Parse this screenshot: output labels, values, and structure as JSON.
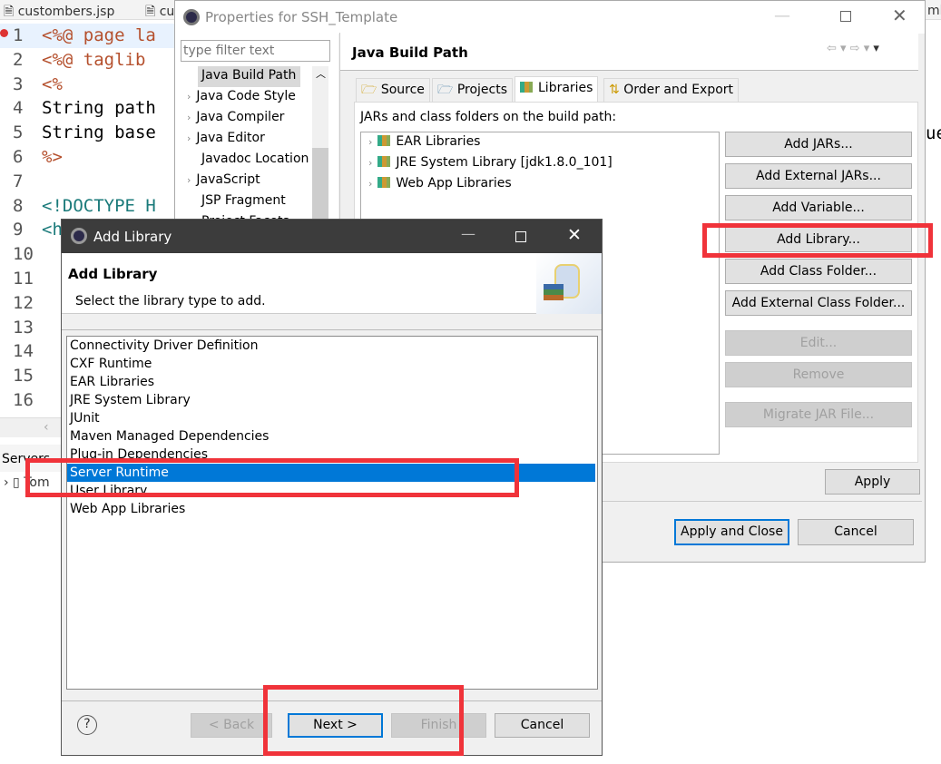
{
  "editor": {
    "tabs": [
      "custombers.jsp",
      "cu"
    ],
    "right_fragments": [
      "ml",
      "ue"
    ],
    "line_numbers": [
      "1",
      "2",
      "3",
      "4",
      "5",
      "6",
      "7",
      "8",
      "9",
      "10",
      "11",
      "12",
      "13",
      "14",
      "15",
      "16"
    ],
    "code_lines": [
      "<%@ page la",
      "<%@ taglib",
      "<%",
      "String path",
      "String base",
      "%>",
      "",
      "<!DOCTYPE H",
      "<h",
      "",
      "",
      "",
      "",
      "",
      "",
      ""
    ],
    "servers_label": "Servers",
    "server_item": "Tom"
  },
  "properties": {
    "title": "Properties for SSH_Template",
    "filter_placeholder": "type filter text",
    "tree": [
      "Java Build Path",
      "Java Code Style",
      "Java Compiler",
      "Java Editor",
      "Javadoc Location",
      "JavaScript",
      "JSP Fragment",
      "Project Facets"
    ],
    "page_title": "Java Build Path",
    "tabs": [
      "Source",
      "Projects",
      "Libraries",
      "Order and Export"
    ],
    "active_tab": "Libraries",
    "list_label": "JARs and class folders on the build path:",
    "libraries": [
      "EAR Libraries",
      "JRE System Library [jdk1.8.0_101]",
      "Web App Libraries"
    ],
    "buttons": {
      "add_jars": "Add JARs...",
      "add_external_jars": "Add External JARs...",
      "add_variable": "Add Variable...",
      "add_library": "Add Library...",
      "add_class_folder": "Add Class Folder...",
      "add_external_class_folder": "Add External Class Folder...",
      "edit": "Edit...",
      "remove": "Remove",
      "migrate": "Migrate JAR File...",
      "apply": "Apply",
      "apply_close": "Apply and Close",
      "cancel": "Cancel"
    }
  },
  "add_library": {
    "title": "Add Library",
    "heading": "Add Library",
    "subtitle": "Select the library type to add.",
    "items": [
      "Connectivity Driver Definition",
      "CXF Runtime",
      "EAR Libraries",
      "JRE System Library",
      "JUnit",
      "Maven Managed Dependencies",
      "Plug-in Dependencies",
      "Server Runtime",
      "User Library",
      "Web App Libraries"
    ],
    "selected": "Server Runtime",
    "buttons": {
      "back": "< Back",
      "next": "Next >",
      "finish": "Finish",
      "cancel": "Cancel"
    }
  },
  "colors": {
    "selection": "#0078d7",
    "highlight_box": "#f0333a",
    "dialog_titlebar": "#3c3c3c"
  }
}
